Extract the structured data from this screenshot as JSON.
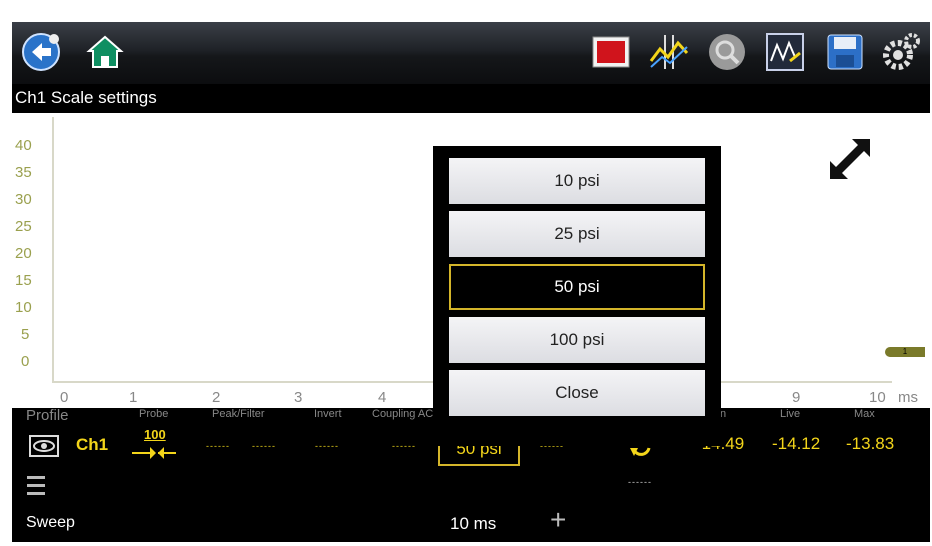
{
  "toolbar": {
    "buttons": [
      {
        "icon": "back-icon"
      },
      {
        "icon": "home-icon"
      },
      {
        "icon": "stop-record-icon"
      },
      {
        "icon": "cursor-split-icon"
      },
      {
        "icon": "zoom-icon"
      },
      {
        "icon": "scope-settings-icon"
      },
      {
        "icon": "save-icon"
      },
      {
        "icon": "settings-gear-icon"
      }
    ]
  },
  "title": "Ch1 Scale settings",
  "plot": {
    "y_ticks": [
      "40",
      "35",
      "30",
      "25",
      "20",
      "15",
      "10",
      "5",
      "0"
    ],
    "x_ticks": [
      "0",
      "1",
      "2",
      "3",
      "4",
      "9",
      "10"
    ],
    "x_unit": "ms",
    "marker_label": "1"
  },
  "popup": {
    "options": [
      "10 psi",
      "25 psi",
      "50 psi",
      "100 psi"
    ],
    "selected": "50 psi",
    "close_label": "Close"
  },
  "column_labels": {
    "profile": "Profile",
    "probe": "Probe",
    "peak_filter": "Peak/Filter",
    "invert": "Invert",
    "coupling": "Coupling AC",
    "min": "n",
    "live": "Live",
    "max": "Max"
  },
  "channel": {
    "name": "Ch1",
    "probe_value": "100",
    "placeholder": "------",
    "scale": "50 psi",
    "min": "-14.49",
    "live": "-14.12",
    "max": "-13.83"
  },
  "sweep": {
    "label": "Sweep",
    "value": "10 ms",
    "increase_symbol": "+"
  },
  "colors": {
    "accent_yellow": "#f3d51a",
    "stop_red": "#d0141c",
    "axis_olive": "#9aa04e"
  }
}
